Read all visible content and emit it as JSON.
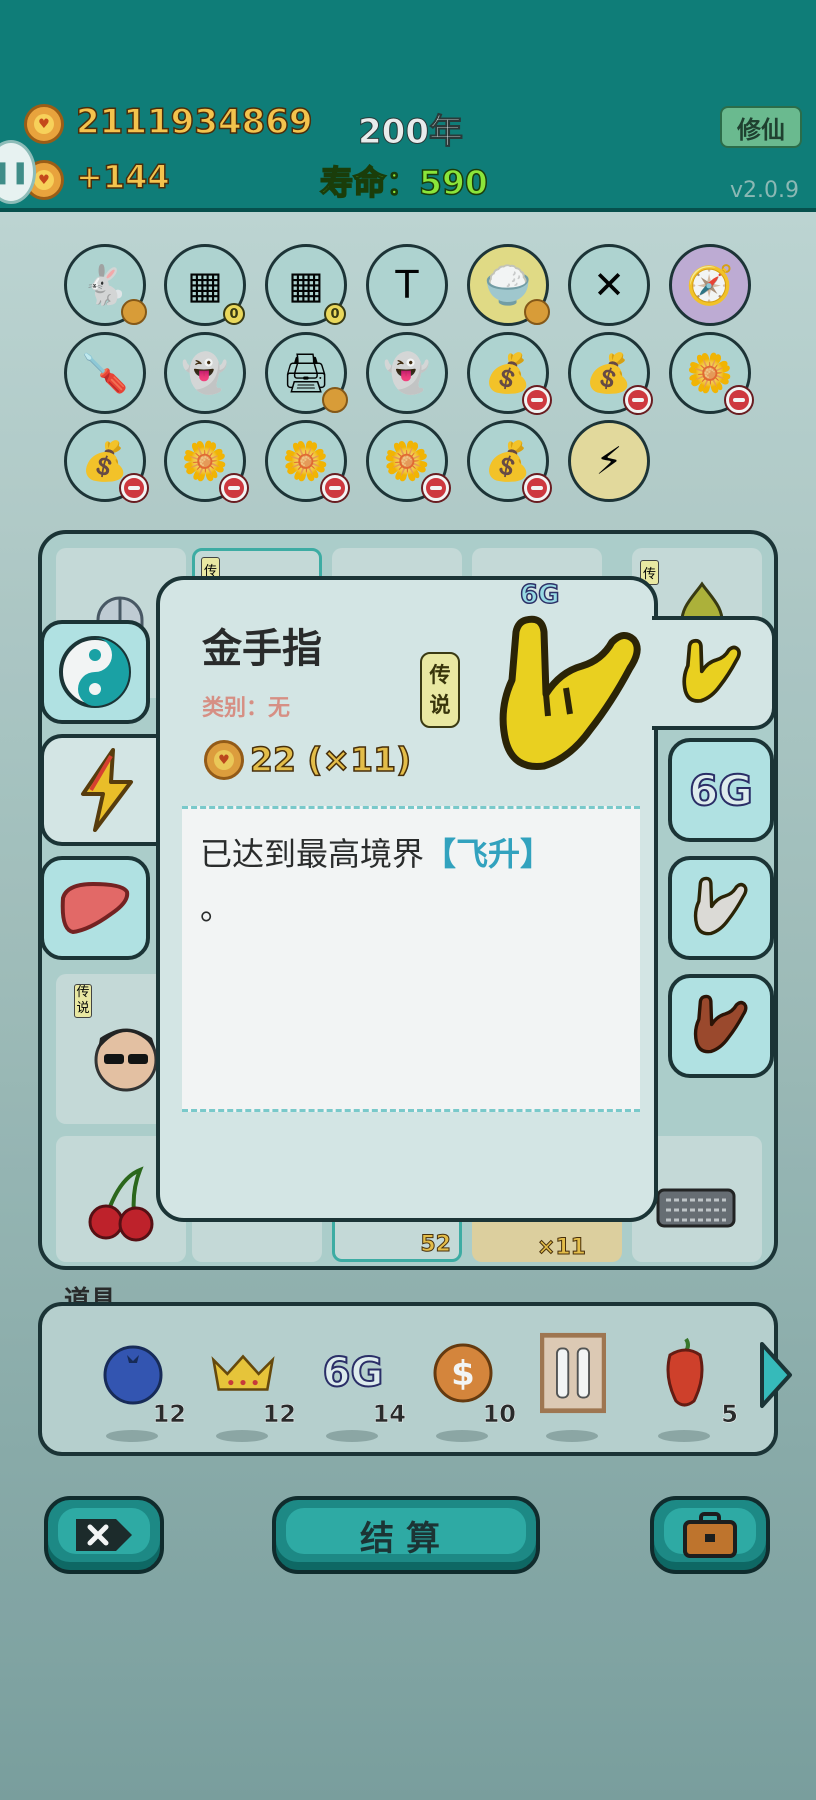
{
  "header": {
    "gold": "2111934869",
    "income": "+144",
    "year": "200年",
    "lifespan": "寿命：590",
    "xiuxian_button": "修仙",
    "version": "v2.0.9"
  },
  "inventory_icons": [
    "rabbit-icon",
    "egg-tray-icon",
    "egg-tray-icon",
    "time-magazine-icon",
    "rice-bowl-icon",
    "crossed-sticks-icon",
    "compass-icon",
    "screwdriver-icon",
    "ghost-icon",
    "printer-icon",
    "ghost-icon",
    "money-bag-icon",
    "money-bag-icon",
    "flower-pot-icon",
    "money-bag-icon",
    "flower-pot-icon",
    "flower-pot-icon",
    "flower-pot-icon",
    "money-bag-icon",
    "lightning-icon"
  ],
  "inventory_badges": {
    "egg_tray_count": "0"
  },
  "popup": {
    "title": "金手指",
    "category": "类别：无",
    "rarity": "传说",
    "price": "22 (×11)",
    "tag": "6G",
    "description": "已达到最高境界",
    "description_highlight": "【飞升】",
    "description_end": "。"
  },
  "board_labels": {
    "legend_a": "传",
    "legend_b": "传说",
    "count_52": "52",
    "count_x11": "×11"
  },
  "side_tabs_left": [
    "yin-yang-icon",
    "lightning-icon",
    "liver-icon"
  ],
  "side_tabs_right": [
    "golden-finger-icon",
    "6g-icon",
    "white-finger-icon",
    "brown-finger-icon"
  ],
  "side_tab_6g_label": "6G",
  "props": {
    "label": "道具",
    "items": [
      {
        "icon": "blueberry-icon",
        "count": "12"
      },
      {
        "icon": "crown-icon",
        "count": "12"
      },
      {
        "icon": "6g-icon",
        "label": "6G",
        "count": "14"
      },
      {
        "icon": "dollar-coin-icon",
        "count": "10"
      },
      {
        "icon": "framed-remotes-icon",
        "count": ""
      },
      {
        "icon": "chili-icon",
        "count": "5"
      }
    ]
  },
  "buttons": {
    "settle": "结算"
  },
  "colors": {
    "header_bg": "#0f7d78",
    "accent_teal": "#1d8e8a",
    "gold": "#f3c34d",
    "life_green": "#8be53a"
  }
}
